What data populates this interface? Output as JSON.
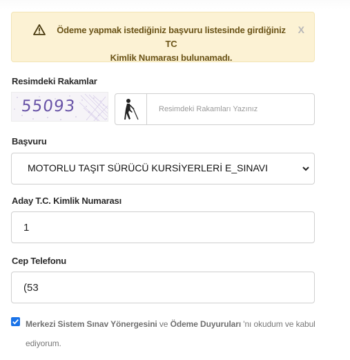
{
  "alert": {
    "message_line1": "Ödeme yapmak istediğiniz başvuru listesinde girdiğiniz TC",
    "message_line2": "Kimlik Numarası bulunamadı.",
    "close_label": "X"
  },
  "captcha": {
    "label": "Resimdeki Rakamlar",
    "code": "55093",
    "placeholder": "Resimdeki Rakamları Yazınız"
  },
  "application": {
    "label": "Başvuru",
    "selected": "MOTORLU TAŞIT SÜRÜCÜ KURSİYERLERİ E_SINAVI"
  },
  "tc": {
    "label": "Aday T.C. Kimlik Numarası",
    "value": "1"
  },
  "phone": {
    "label": "Cep Telefonu",
    "value": "(53"
  },
  "consent": {
    "link1": "Merkezi Sistem Sınav Yönergesini",
    "joiner": " ve ",
    "link2": "Ödeme Duyuruları",
    "suffix": " 'nı okudum ve kabul ediyorum.",
    "checked": true
  },
  "colors": {
    "alert_bg": "#fcf2d4",
    "alert_text": "#6b5418",
    "checkbox_accent": "#1a73e8"
  }
}
